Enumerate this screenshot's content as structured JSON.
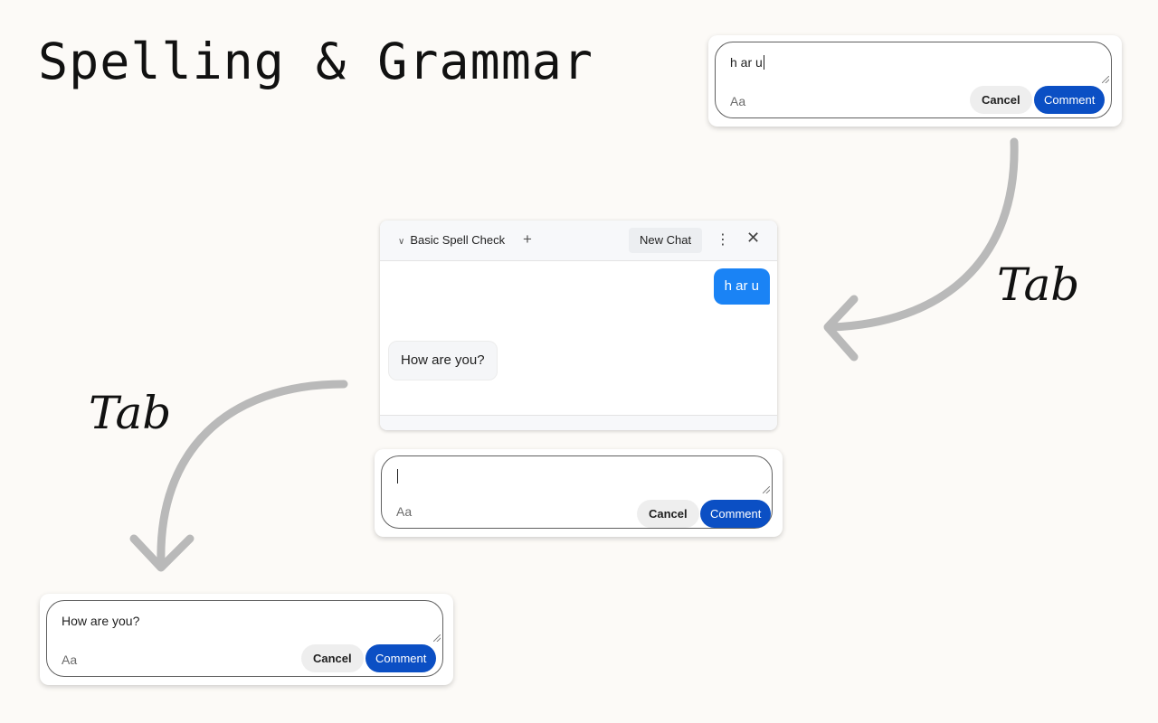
{
  "headline": "Spelling & Grammar",
  "tab_labels": {
    "right": "Tab",
    "left": "Tab"
  },
  "arrow_color": "#b9b9b9",
  "accent_color": "#0b4fc4",
  "bubble_color": "#1a83f5",
  "comment_boxes": [
    {
      "id": "top",
      "text": "h ar u",
      "format_label": "Aa",
      "cancel_label": "Cancel",
      "submit_label": "Comment"
    },
    {
      "id": "middle",
      "text": "",
      "format_label": "Aa",
      "cancel_label": "Cancel",
      "submit_label": "Comment"
    },
    {
      "id": "bottom",
      "text": "How are you?",
      "format_label": "Aa",
      "cancel_label": "Cancel",
      "submit_label": "Comment"
    }
  ],
  "chat": {
    "title": "Basic Spell Check",
    "new_chat_label": "New Chat",
    "messages": [
      {
        "role": "user",
        "text": "h ar u"
      },
      {
        "role": "assistant",
        "text": "How are you?"
      }
    ]
  }
}
